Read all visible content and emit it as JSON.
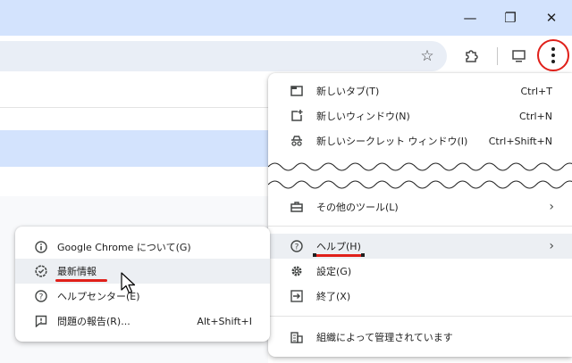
{
  "window": {
    "minimize_glyph": "—",
    "restore_glyph": "❐",
    "close_glyph": "✕"
  },
  "toolbar": {
    "bookmark_glyph": "☆",
    "extensions_glyph": "⧉",
    "cast_glyph": "▭"
  },
  "menu": {
    "new_tab": {
      "label": "新しいタブ(T)",
      "shortcut": "Ctrl+T"
    },
    "new_window": {
      "label": "新しいウィンドウ(N)",
      "shortcut": "Ctrl+N"
    },
    "new_incognito": {
      "label": "新しいシークレット ウィンドウ(I)",
      "shortcut": "Ctrl+Shift+N"
    },
    "more_tools": {
      "label": "その他のツール(L)"
    },
    "help": {
      "label": "ヘルプ(H)"
    },
    "settings": {
      "label": "設定(G)"
    },
    "exit": {
      "label": "終了(X)"
    },
    "managed": {
      "label": "組織によって管理されています"
    },
    "chevron": "›"
  },
  "help_submenu": {
    "about": {
      "label": "Google Chrome について(G)"
    },
    "whats_new": {
      "label": "最新情報"
    },
    "help_center": {
      "label": "ヘルプセンター(E)"
    },
    "report_issue": {
      "label": "問題の報告(R)...",
      "shortcut": "Alt+Shift+I"
    }
  },
  "colors": {
    "annotation_red": "#e0201a",
    "titlebar_blue": "#d3e3fd",
    "highlight_gray": "#eceff3"
  }
}
